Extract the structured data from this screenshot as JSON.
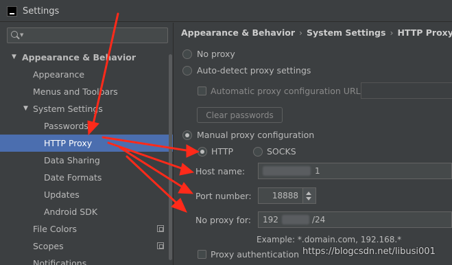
{
  "window": {
    "title": "Settings"
  },
  "sidebar": {
    "search": {
      "value": "",
      "placeholder": ""
    },
    "items": [
      {
        "label": "Appearance & Behavior",
        "level": 0,
        "arrow": "▼"
      },
      {
        "label": "Appearance",
        "level": 1
      },
      {
        "label": "Menus and Toolbars",
        "level": 1
      },
      {
        "label": "System Settings",
        "level": 1,
        "arrow": "▼"
      },
      {
        "label": "Passwords",
        "level": 2
      },
      {
        "label": "HTTP Proxy",
        "level": 2,
        "selected": true
      },
      {
        "label": "Data Sharing",
        "level": 2
      },
      {
        "label": "Date Formats",
        "level": 2
      },
      {
        "label": "Updates",
        "level": 2
      },
      {
        "label": "Android SDK",
        "level": 2
      },
      {
        "label": "File Colors",
        "level": 1,
        "project_icon": true
      },
      {
        "label": "Scopes",
        "level": 1,
        "project_icon": true
      },
      {
        "label": "Notifications",
        "level": 1
      }
    ]
  },
  "breadcrumb": [
    "Appearance & Behavior",
    "System Settings",
    "HTTP Proxy"
  ],
  "proxy": {
    "no_proxy": "No proxy",
    "auto_detect": "Auto-detect proxy settings",
    "auto_config_url": "Automatic proxy configuration URL:",
    "clear_passwords": "Clear passwords",
    "manual": "Manual proxy configuration",
    "http": "HTTP",
    "socks": "SOCKS",
    "host_label": "Host name:",
    "host_value": "1",
    "port_label": "Port number:",
    "port_value": "18888",
    "no_proxy_for_label": "No proxy for:",
    "no_proxy_for_value_start": "192",
    "no_proxy_for_value_end": "/24",
    "example": "Example: *.domain.com, 192.168.*",
    "auth": "Proxy authentication"
  },
  "watermark": "https://blogcsdn.net/libusi001",
  "colors": {
    "background": "#3c3f41",
    "selection": "#4b6eaf",
    "annotation_arrow": "#ff2a1a"
  }
}
